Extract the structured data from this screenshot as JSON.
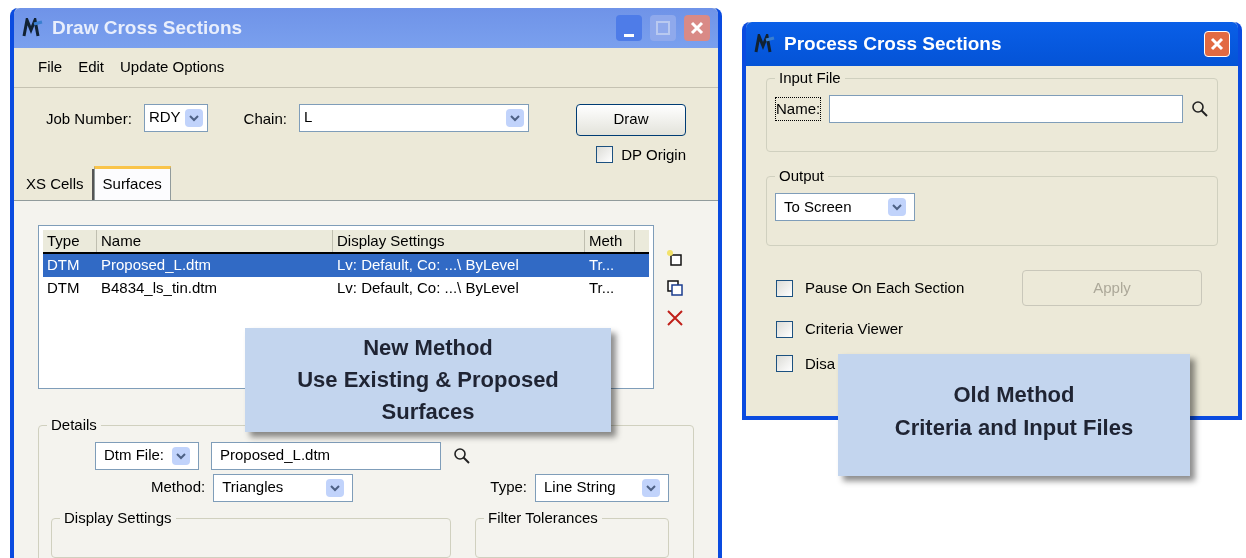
{
  "draw_window": {
    "title": "Draw Cross Sections",
    "menu": [
      "File",
      "Edit",
      "Update Options"
    ],
    "job_number": {
      "label": "Job Number:",
      "value": "RDY"
    },
    "chain": {
      "label": "Chain:",
      "value": "L"
    },
    "draw_button": "Draw",
    "dp_origin": {
      "label": "DP Origin",
      "checked": false
    },
    "tabs": [
      {
        "label": "XS Cells",
        "selected": false
      },
      {
        "label": "Surfaces",
        "selected": true
      }
    ],
    "table": {
      "columns": [
        "Type",
        "Name",
        "Display Settings",
        "Meth"
      ],
      "rows": [
        {
          "type": "DTM",
          "name": "Proposed_L.dtm",
          "display": "Lv: Default, Co: ...\\ ByLevel",
          "method": "Tr...",
          "selected": true
        },
        {
          "type": "DTM",
          "name": "B4834_ls_tin.dtm",
          "display": "Lv: Default, Co: ...\\ ByLevel",
          "method": "Tr...",
          "selected": false
        }
      ]
    },
    "details": {
      "title": "Details",
      "source": "Dtm File:",
      "file": "Proposed_L.dtm",
      "method_label": "Method:",
      "method": "Triangles",
      "type_label": "Type:",
      "type": "Line String",
      "display_settings": "Display Settings",
      "filter_tolerances": "Filter Tolerances"
    }
  },
  "process_window": {
    "title": "Process Cross Sections",
    "input_file": {
      "title": "Input File",
      "name_label": "Name:"
    },
    "output": {
      "title": "Output",
      "value": "To Screen"
    },
    "options": [
      {
        "label": "Pause On Each Section",
        "checked": false
      },
      {
        "label": "Criteria Viewer",
        "checked": false
      },
      {
        "label": "Disa",
        "checked": false
      }
    ],
    "apply": {
      "label": "Apply",
      "disabled": true
    }
  },
  "callouts": [
    {
      "lines": [
        "New Method",
        "Use Existing & Proposed",
        "Surfaces"
      ]
    },
    {
      "lines": [
        "Old Method",
        "Criteria and Input Files"
      ]
    }
  ]
}
